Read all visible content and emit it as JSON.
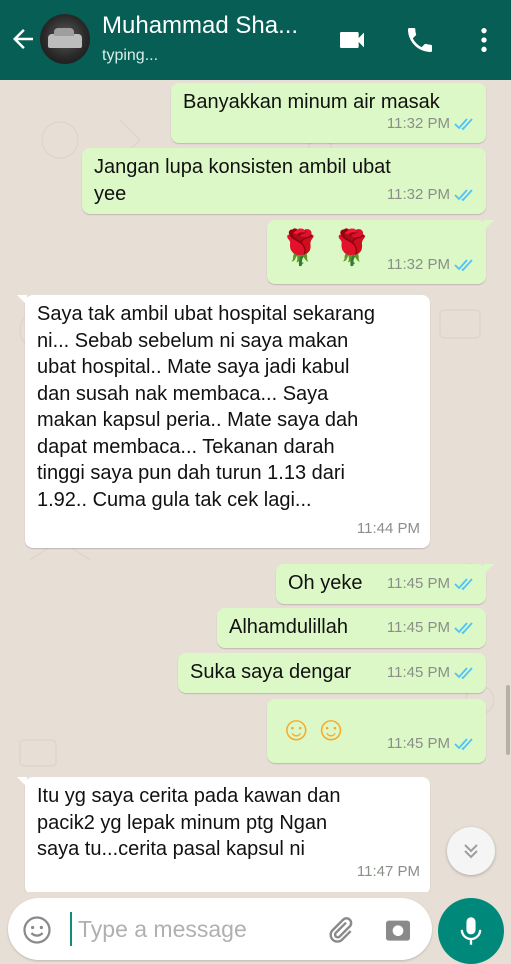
{
  "header": {
    "contact_name": "Muhammad Sha...",
    "status": "typing...",
    "icons": [
      "back-arrow-icon",
      "video-call-icon",
      "phone-icon",
      "more-options-icon"
    ]
  },
  "messages": [
    {
      "direction": "out",
      "text": "Banyakkan minum air masak",
      "time": "11:32 PM",
      "read": true
    },
    {
      "direction": "out",
      "text": "Jangan lupa konsisten ambil ubat\nyee",
      "time": "11:32 PM",
      "read": true
    },
    {
      "direction": "out",
      "text": "🌹 🌹",
      "time": "11:32 PM",
      "read": true
    },
    {
      "direction": "in",
      "text": "Saya tak ambil ubat hospital sekarang\nni... Sebab sebelum ni saya makan\nubat hospital.. Mate saya jadi kabul\ndan susah nak membaca... Saya\nmakan kapsul peria.. Mate saya dah\ndapat membaca... Tekanan darah\ntinggi saya pun dah turun 1.13 dari\n1.92.. Cuma gula tak cek lagi...",
      "time": "11:44 PM"
    },
    {
      "direction": "out",
      "text": "Oh yeke",
      "time": "11:45 PM",
      "read": true
    },
    {
      "direction": "out",
      "text": "Alhamdulillah",
      "time": "11:45 PM",
      "read": true
    },
    {
      "direction": "out",
      "text": "Suka saya dengar",
      "time": "11:45 PM",
      "read": true
    },
    {
      "direction": "out",
      "text": "☺☺",
      "time": "11:45 PM",
      "read": true
    },
    {
      "direction": "in",
      "text": "Itu yg saya cerita pada kawan dan\npacik2  yg lepak minum ptg Ngan\nsaya tu...cerita pasal kapsul ni",
      "time": "11:47 PM"
    }
  ],
  "input": {
    "placeholder": "Type a message",
    "value": ""
  },
  "colors": {
    "header": "#075e54",
    "outgoing_bubble": "#dcf8c6",
    "incoming_bubble": "#ffffff",
    "read_ticks": "#4fc3f7",
    "mic_button": "#00897b"
  }
}
